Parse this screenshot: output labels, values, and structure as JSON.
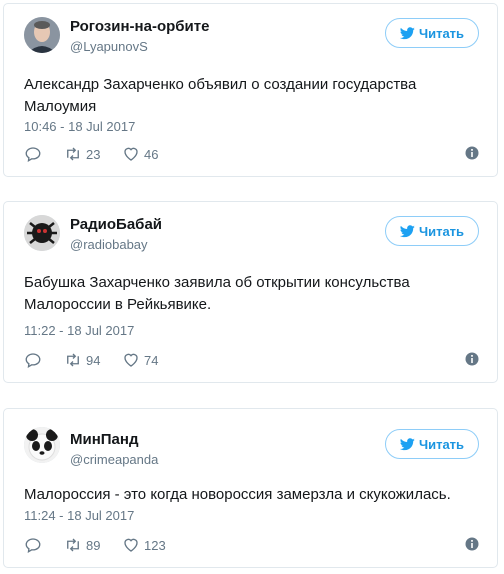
{
  "follow_label": "Читать",
  "tweets": [
    {
      "name": "Рогозин-на-орбите",
      "handle": "@LyapunovS",
      "text": "Александр Захарченко объявил о создании государства Малоумия",
      "time": "10:46 - 18 Jul 2017",
      "retweets": "23",
      "likes": "46"
    },
    {
      "name": "РадиоБабай",
      "handle": "@radiobabay",
      "text": "Бабушка Захарченко заявила об открытии консульства Малороссии в Рейкьявике.",
      "time": "11:22 - 18 Jul 2017",
      "retweets": "94",
      "likes": "74"
    },
    {
      "name": "МинПанд",
      "handle": "@crimeapanda",
      "text": "Малороссия - это когда новороссия замерзла и скукожилась.",
      "time": "11:24 - 18 Jul 2017",
      "retweets": "89",
      "likes": "123"
    }
  ],
  "colors": {
    "accent": "#1b95e0",
    "muted": "#657786",
    "border": "#e1e8ed"
  }
}
